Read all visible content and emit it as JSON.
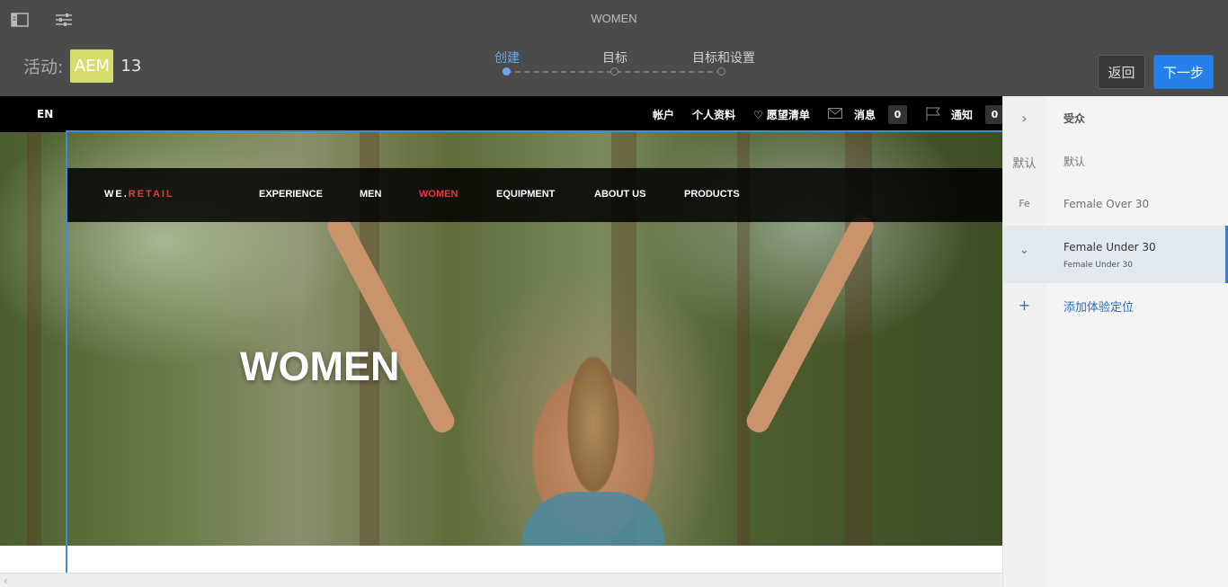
{
  "header": {
    "page_title": "WOMEN",
    "activity_label": "活动:",
    "activity_badge": "AEM",
    "activity_count": "13",
    "steps": [
      {
        "label": "创建"
      },
      {
        "label": "目标"
      },
      {
        "label": "目标和设置"
      }
    ],
    "back_label": "返回",
    "next_label": "下一步"
  },
  "site": {
    "topnav": {
      "lang": "EN",
      "account": "帐户",
      "profile": "个人资料",
      "wishlist": "♡ 愿望清单",
      "messages": "消息",
      "messages_count": "0",
      "notifications": "通知",
      "notifications_count": "0"
    },
    "logo_we": "WE.",
    "logo_retail": "RETAIL",
    "nav": [
      "EXPERIENCE",
      "MEN",
      "WOMEN",
      "EQUIPMENT",
      "ABOUT US",
      "PRODUCTS"
    ],
    "hero_title": "WOMEN"
  },
  "panel": {
    "audience_header": "受众",
    "rows": [
      {
        "icon": "默认",
        "label": "默认"
      },
      {
        "icon": "Fe",
        "label": "Female Over 30"
      },
      {
        "icon": "⌄",
        "label": "Female Under 30",
        "sub": "Female Under 30"
      }
    ],
    "add_label": "添加体验定位",
    "add_icon": "+"
  },
  "colors": {
    "accent": "#2680eb",
    "badge": "#d6dd6c",
    "brand_red": "#e33d3d"
  }
}
